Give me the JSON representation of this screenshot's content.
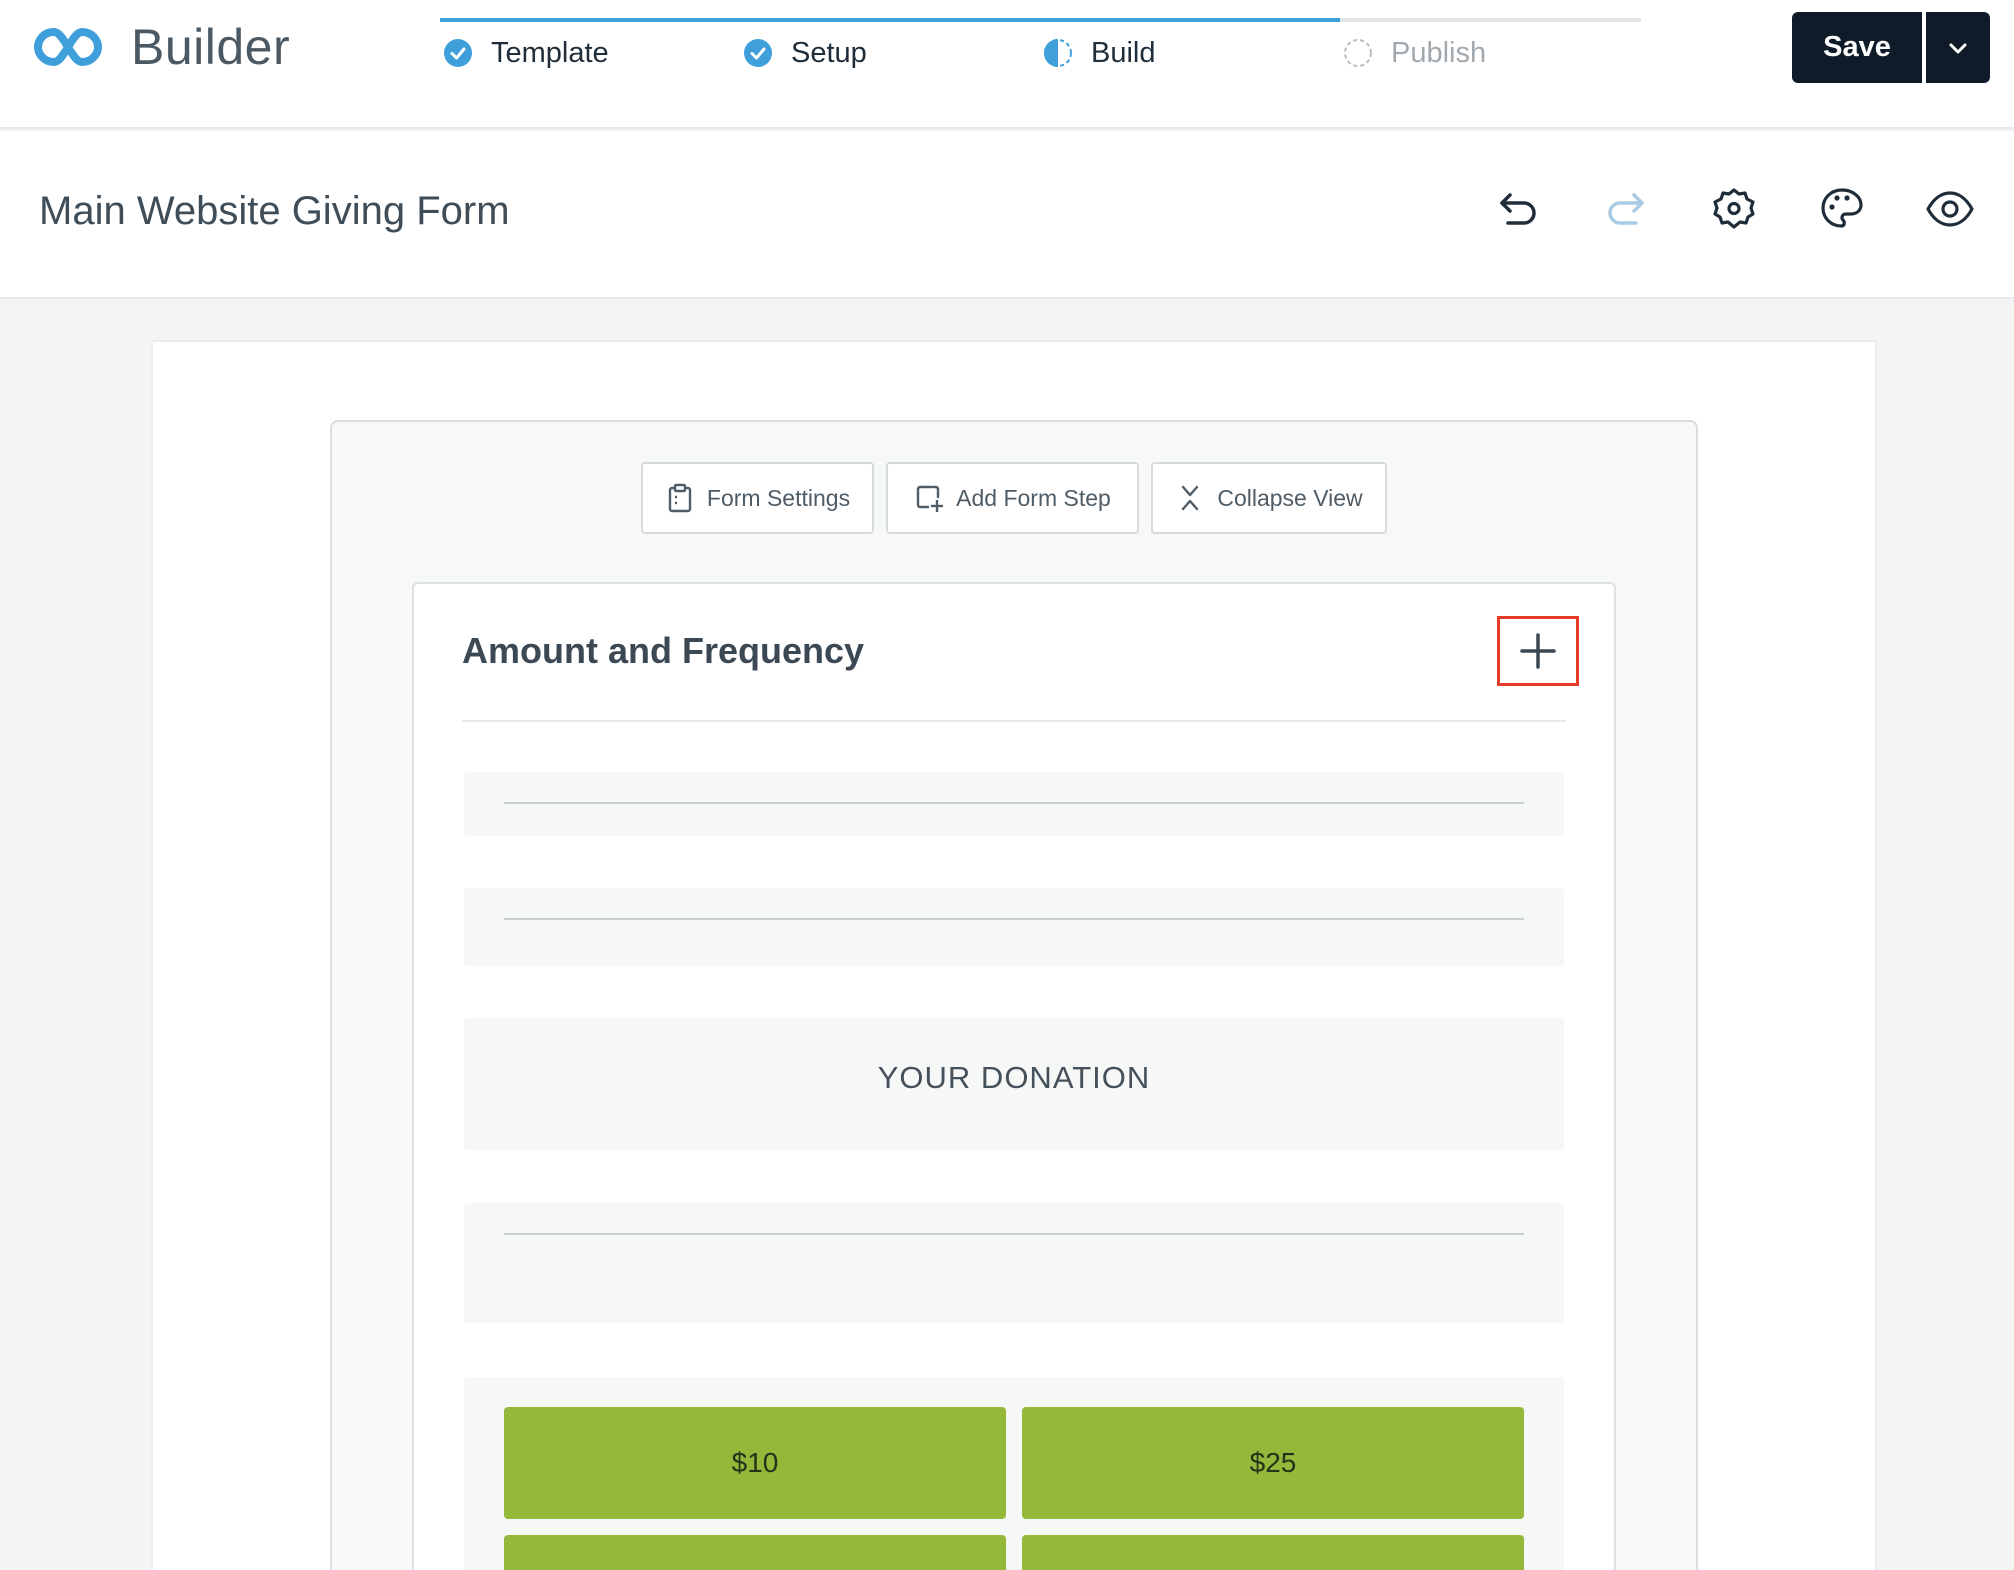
{
  "app": {
    "brand": "Builder",
    "steps": [
      {
        "label": "Template",
        "state": "complete"
      },
      {
        "label": "Setup",
        "state": "complete"
      },
      {
        "label": "Build",
        "state": "current"
      },
      {
        "label": "Publish",
        "state": "pending"
      }
    ],
    "save_label": "Save"
  },
  "titlebar": {
    "form_title": "Main Website Giving Form",
    "tools": [
      "undo-icon",
      "redo-icon",
      "settings-gear-icon",
      "palette-icon",
      "preview-eye-icon"
    ]
  },
  "builder": {
    "actions": {
      "form_settings": "Form Settings",
      "add_form_step": "Add Form Step",
      "collapse_view": "Collapse View"
    },
    "step": {
      "heading": "Amount and Frequency",
      "donation_heading": "YOUR DONATION",
      "amounts": [
        "$10",
        "$25"
      ]
    }
  },
  "colors": {
    "accent": "#3e9fda",
    "save_bg": "#0f1b28",
    "amount_bg": "#93b83a",
    "highlight": "#e53c2a"
  }
}
